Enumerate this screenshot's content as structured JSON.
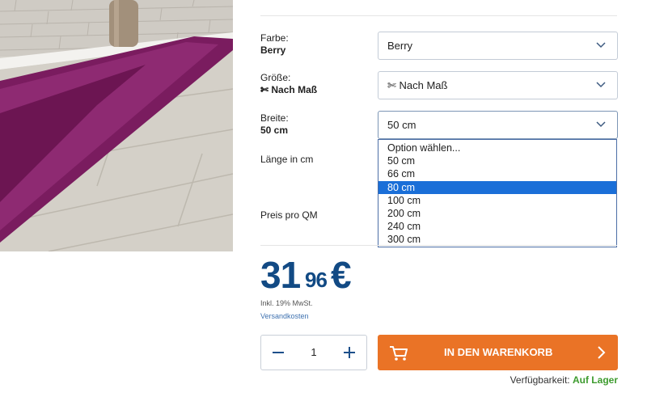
{
  "options": {
    "color": {
      "label": "Farbe:",
      "value": "Berry",
      "selected": "Berry"
    },
    "size": {
      "label": "Größe:",
      "value": "✄ Nach Maß",
      "selected": "✄ Nach Maß"
    },
    "width": {
      "label": "Breite:",
      "value": "50 cm",
      "selected": "50 cm",
      "dropdown": [
        "Option wählen...",
        "50 cm",
        "66 cm",
        "80 cm",
        "100 cm",
        "200 cm",
        "240 cm",
        "300 cm"
      ],
      "highlighted": "80 cm"
    },
    "length": {
      "label": "Länge in cm"
    },
    "price_per_sqm": {
      "label": "Preis pro QM"
    }
  },
  "price": {
    "main": "31",
    "cents": "96",
    "currency": "€"
  },
  "vat_note": "Inkl. 19% MwSt.",
  "shipping_link": "Versandkosten",
  "quantity": {
    "value": "1"
  },
  "cart_button": {
    "label": "IN DEN WARENKORB"
  },
  "availability": {
    "label": "Verfügbarkeit:",
    "status": "Auf Lager"
  },
  "colors": {
    "price_blue": "#124a84",
    "cart_orange": "#ea7326",
    "stock_green": "#3d9b2e",
    "highlight_blue": "#1a6fd8"
  }
}
